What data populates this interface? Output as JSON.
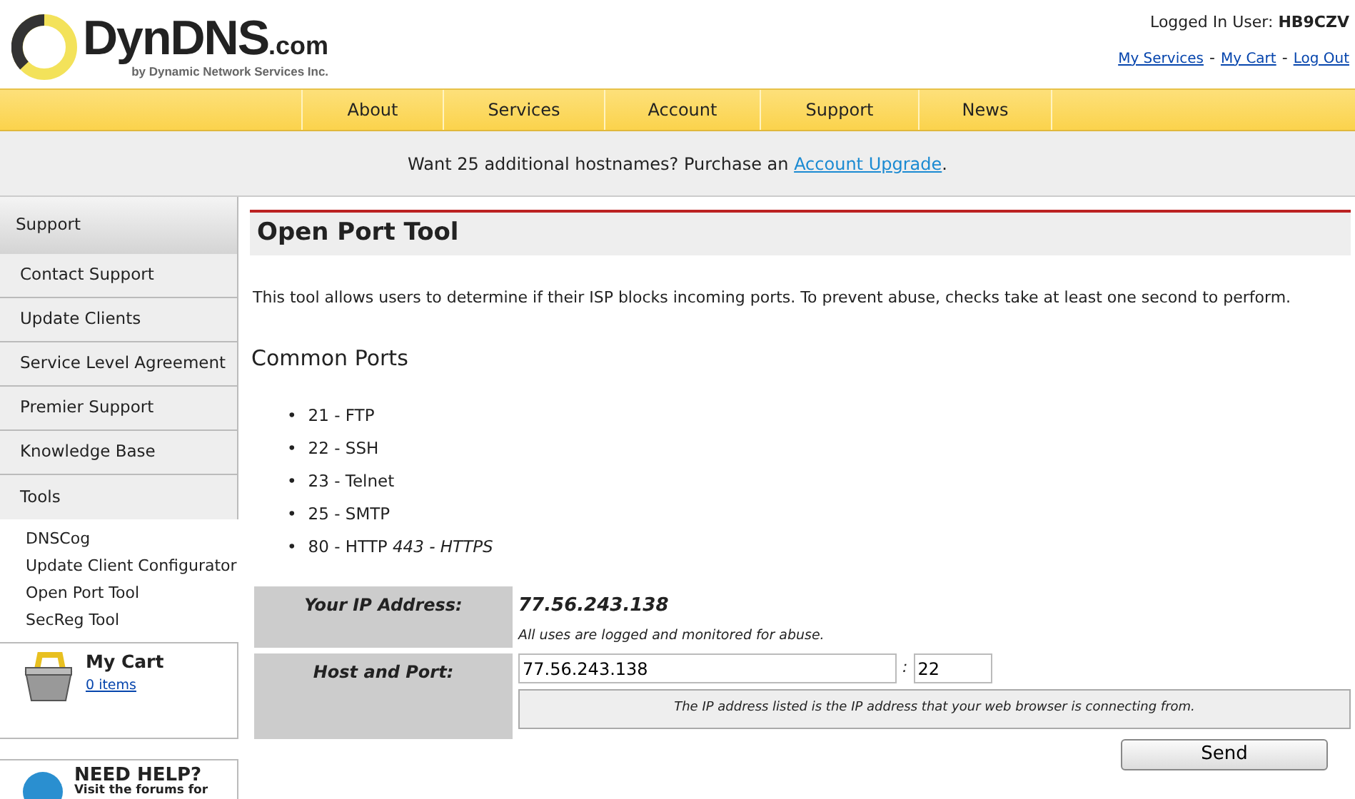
{
  "header": {
    "logo_name": "DynDNS",
    "logo_suffix": ".com",
    "logo_tagline": "by Dynamic Network Services Inc.",
    "user_label": "Logged In User:",
    "user_name": "HB9CZV",
    "user_links": [
      "My Services",
      "My Cart",
      "Log Out"
    ],
    "link_separator": "-"
  },
  "nav": [
    {
      "label": "About"
    },
    {
      "label": "Services"
    },
    {
      "label": "Account"
    },
    {
      "label": "Support"
    },
    {
      "label": "News"
    }
  ],
  "promo": {
    "text": "Want 25 additional hostnames? Purchase an ",
    "link": "Account Upgrade",
    "after": "."
  },
  "sidebar": {
    "heading": "Support",
    "items": [
      {
        "label": "Contact Support"
      },
      {
        "label": "Update Clients"
      },
      {
        "label": "Service Level Agreement"
      },
      {
        "label": "Premier Support"
      },
      {
        "label": "Knowledge Base"
      },
      {
        "label": "Tools",
        "children": [
          {
            "label": "DNSCog"
          },
          {
            "label": "Update Client Configurator"
          },
          {
            "label": "Open Port Tool"
          },
          {
            "label": "SecReg Tool"
          }
        ]
      }
    ],
    "cart": {
      "title": "My Cart",
      "items": "0 items"
    },
    "help": {
      "title": "NEED HELP?",
      "text": "Visit the forums for"
    }
  },
  "main": {
    "title": "Open Port Tool",
    "intro": "This tool allows users to determine if their ISP blocks incoming ports. To prevent abuse, checks take at least one second to perform.",
    "ports_heading": "Common Ports",
    "bullet": "•",
    "ports": [
      "21 - FTP",
      "22 - SSH",
      "23 - Telnet",
      "25 - SMTP",
      "80 - HTTP *443 - HTTPS*"
    ],
    "form": {
      "ip_label": "Your IP Address:",
      "ip_value": "77.56.243.138",
      "ip_note": "All uses are logged and monitored for abuse.",
      "host_label": "Host and Port:",
      "host_value": "77.56.243.138",
      "separator": ":",
      "port_value": "22",
      "host_note": "The IP address listed is the IP address that your web browser is connecting from.",
      "submit": "Send"
    }
  }
}
